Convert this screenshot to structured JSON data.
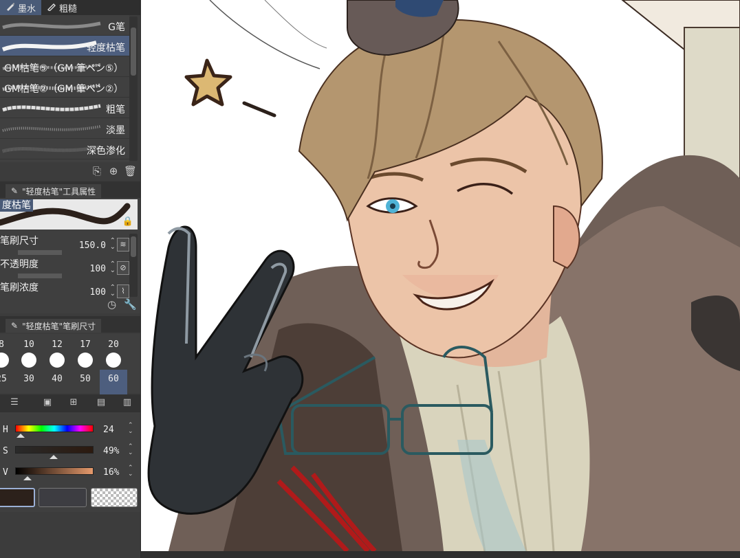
{
  "brush_tabs": [
    {
      "label": "墨水",
      "icon": "ink-brush-icon",
      "active": true
    },
    {
      "label": "粗糙",
      "icon": "rough-brush-icon",
      "active": false
    }
  ],
  "brush_list": [
    {
      "name": "G笔"
    },
    {
      "name": "轻度枯笔",
      "selected": true
    },
    {
      "name": "GM枯笔⑤（GM 筆ペン⑤）"
    },
    {
      "name": "GM枯笔②（GM 筆ペン②）"
    },
    {
      "name": "粗笔"
    },
    {
      "name": "淡墨"
    },
    {
      "name": "深色渗化"
    }
  ],
  "tool_property": {
    "header": "\"轻度枯笔\"工具属性",
    "preview_label": "度枯笔",
    "rows": [
      {
        "label": "笔刷尺寸",
        "value": "150.0"
      },
      {
        "label": "不透明度",
        "value": "100"
      },
      {
        "label": "笔刷浓度",
        "value": "100"
      }
    ]
  },
  "brush_size": {
    "header": "\"轻度枯笔\"笔刷尺寸",
    "row1": [
      "8",
      "10",
      "12",
      "17",
      "20"
    ],
    "row2": [
      "25",
      "30",
      "40",
      "50",
      "60"
    ]
  },
  "color": {
    "h_label": "H",
    "h_value": "24",
    "s_label": "S",
    "s_value": "49%",
    "v_label": "V",
    "v_value": "16%",
    "h_fraction": 0.067,
    "s_fraction": 0.49,
    "v_fraction": 0.16,
    "main_color": "#2c211b",
    "sub_color": "#3d3d42"
  },
  "colors": {
    "panel_bg": "#3c3c3c",
    "selection": "#4d5e7e",
    "canvas_bg": "#ffffff"
  },
  "canvas": {
    "content": "digital illustration artwork"
  }
}
